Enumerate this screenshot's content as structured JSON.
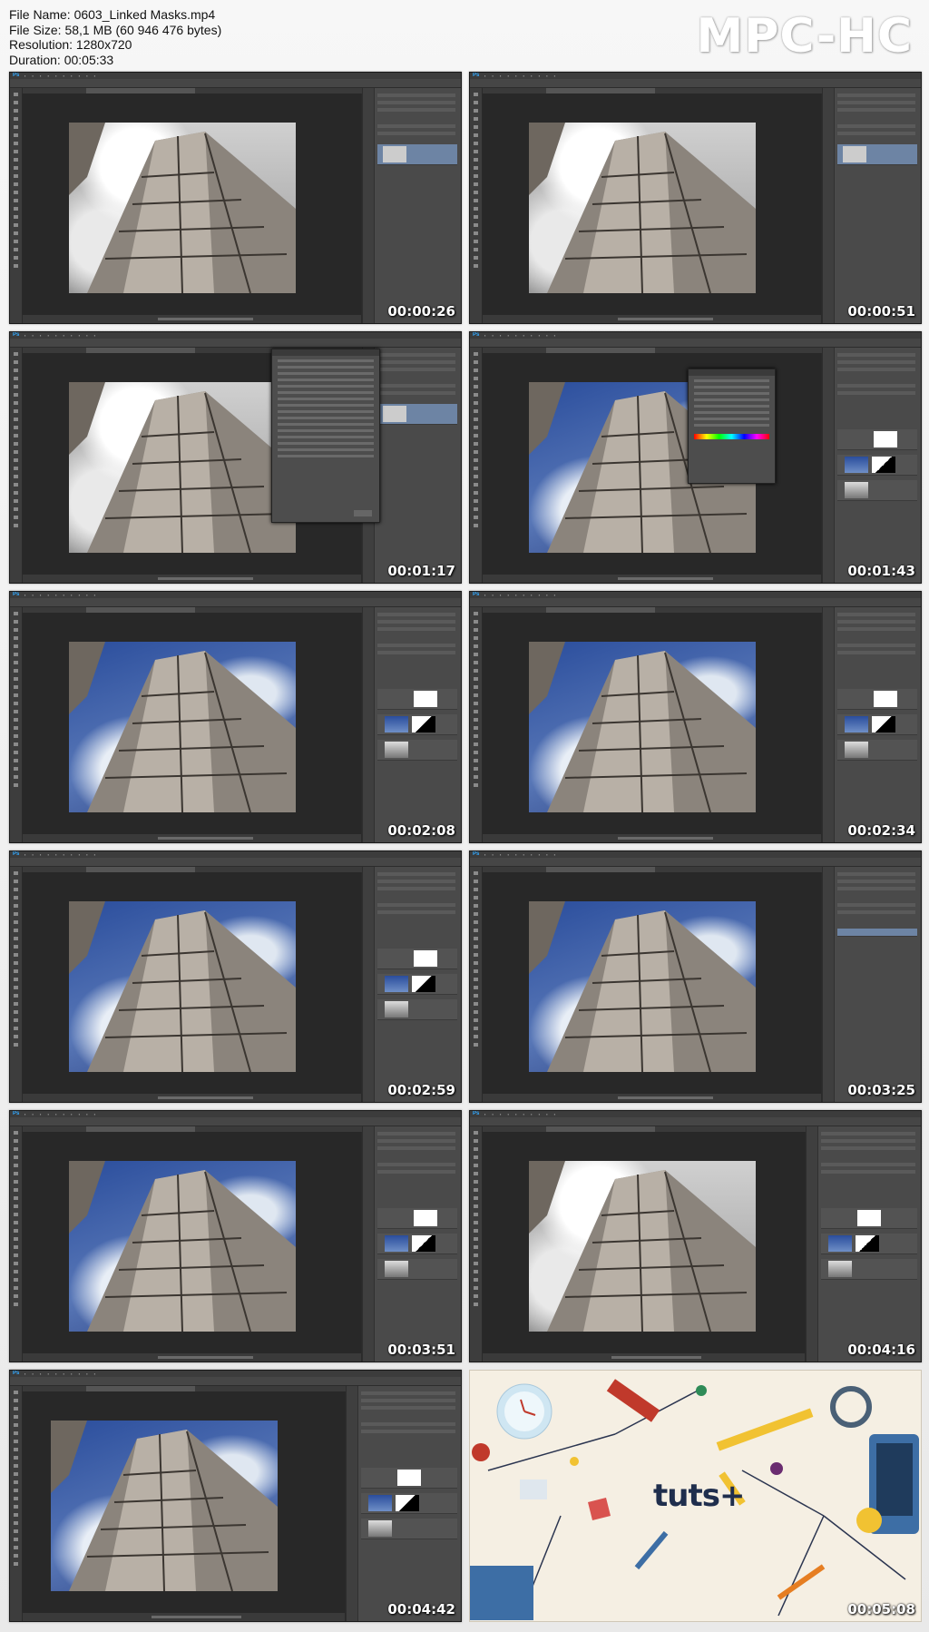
{
  "header": {
    "file_name": "File Name: 0603_Linked Masks.mp4",
    "file_size": "File Size: 58,1 MB (60 946 476 bytes)",
    "resolution": "Resolution: 1280x720",
    "duration": "Duration: 00:05:33"
  },
  "brand": "MPC-HC",
  "thumbnails": [
    {
      "timestamp": "00:00:26"
    },
    {
      "timestamp": "00:00:51"
    },
    {
      "timestamp": "00:01:17"
    },
    {
      "timestamp": "00:01:43"
    },
    {
      "timestamp": "00:02:08"
    },
    {
      "timestamp": "00:02:34"
    },
    {
      "timestamp": "00:02:59"
    },
    {
      "timestamp": "00:03:25"
    },
    {
      "timestamp": "00:03:51"
    },
    {
      "timestamp": "00:04:16"
    },
    {
      "timestamp": "00:04:42"
    },
    {
      "timestamp": "00:05:08"
    }
  ],
  "final_frame": {
    "logo": "tuts+"
  },
  "ps_logo": "Ps",
  "colors": {
    "background": "#f0f0f0",
    "ps_dark": "#2a2a2a",
    "panel": "#4a4a4a",
    "selected_layer": "#6d84a4",
    "tuts_navy": "#1f2e4d"
  }
}
